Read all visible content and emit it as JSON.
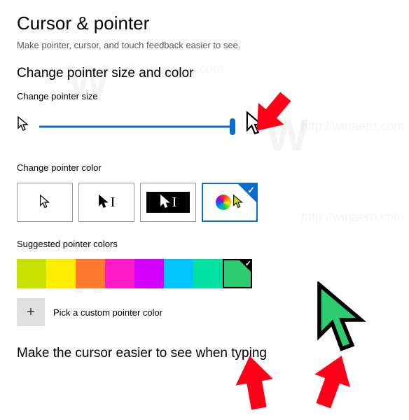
{
  "page": {
    "title": "Cursor & pointer",
    "subtitle": "Make pointer, cursor, and touch feedback easier to see."
  },
  "sections": {
    "size_color_heading": "Change pointer size and color",
    "size_label": "Change pointer size",
    "color_label": "Change pointer color",
    "suggested_label": "Suggested pointer colors",
    "custom_label": "Pick a custom pointer color",
    "bottom_heading": "Make the cursor easier to see when typing"
  },
  "slider": {
    "value": 100,
    "min": 0,
    "max": 100
  },
  "color_options": [
    {
      "id": "white",
      "selected": false
    },
    {
      "id": "black",
      "selected": false
    },
    {
      "id": "inverted",
      "selected": false
    },
    {
      "id": "custom",
      "selected": true
    }
  ],
  "suggested_colors": [
    {
      "hex": "#c6e000",
      "selected": false
    },
    {
      "hex": "#ffee00",
      "selected": false
    },
    {
      "hex": "#ff7a2f",
      "selected": false
    },
    {
      "hex": "#ff1ac6",
      "selected": false
    },
    {
      "hex": "#d400ff",
      "selected": false
    },
    {
      "hex": "#00c4ff",
      "selected": false
    },
    {
      "hex": "#00e0a0",
      "selected": false
    },
    {
      "hex": "#2dcc70",
      "selected": true
    }
  ],
  "icons": {
    "plus": "+",
    "check": "✓",
    "ibeam": "I"
  },
  "watermark": {
    "logo": "W",
    "url": "http://winaero.com"
  }
}
